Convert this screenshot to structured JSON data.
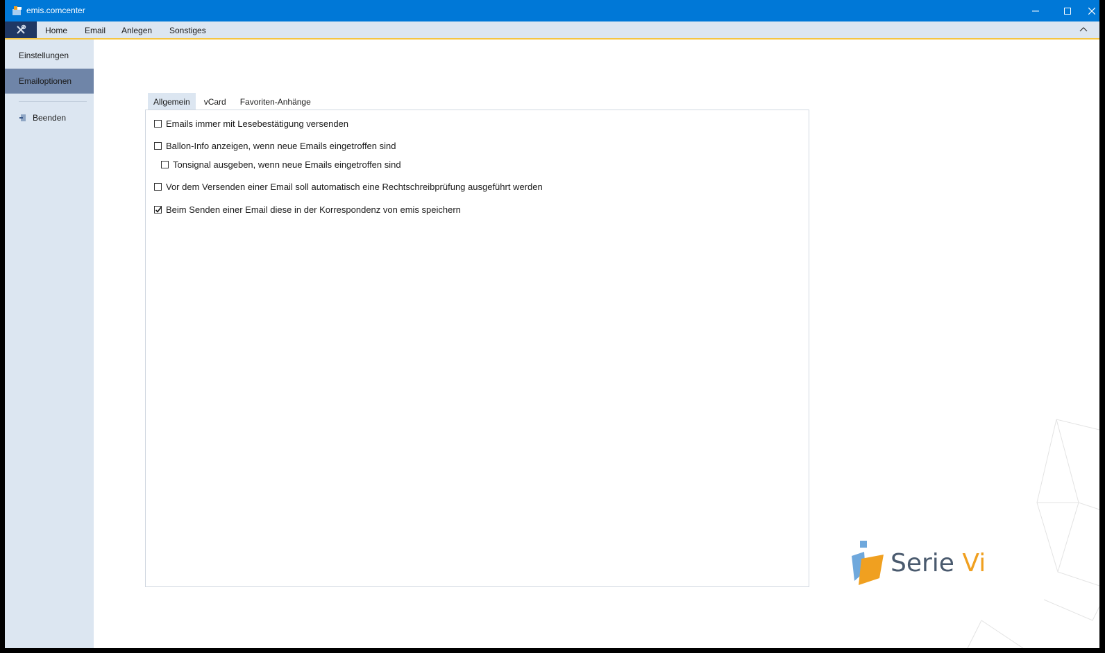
{
  "window": {
    "title": "emis.comcenter"
  },
  "ribbon": {
    "tabs": [
      "Home",
      "Email",
      "Anlegen",
      "Sonstiges"
    ]
  },
  "sidebar": {
    "items": [
      {
        "label": "Einstellungen",
        "active": false
      },
      {
        "label": "Emailoptionen",
        "active": true
      }
    ],
    "quit_label": "Beenden"
  },
  "main": {
    "tabs": [
      {
        "label": "Allgemein",
        "active": true
      },
      {
        "label": "vCard",
        "active": false
      },
      {
        "label": "Favoriten-Anhänge",
        "active": false
      }
    ],
    "options": [
      {
        "label": "Emails immer mit Lesebestätigung versenden",
        "checked": false
      },
      {
        "label": "Ballon-Info anzeigen, wenn neue Emails eingetroffen sind",
        "checked": false
      },
      {
        "label": "Tonsignal ausgeben, wenn neue Emails eingetroffen sind",
        "checked": false
      },
      {
        "label": "Vor dem Versenden einer Email soll automatisch eine Rechtschreibprüfung ausgeführt werden",
        "checked": false
      },
      {
        "label": "Beim Senden einer Email diese in der Korrespondenz von emis speichern",
        "checked": true
      }
    ]
  },
  "logo": {
    "text_main": "Serie",
    "text_accent": "Vi"
  },
  "colors": {
    "titlebar": "#0078d7",
    "ribbon_bg": "#dce6f1",
    "sidebar_active": "#6f85a8",
    "accent_line": "#f5c542",
    "logo_accent": "#f0a020"
  }
}
